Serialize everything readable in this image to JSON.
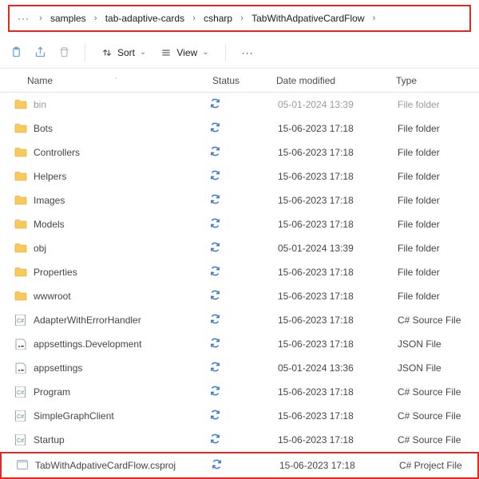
{
  "breadcrumb": {
    "ellipsis": "···",
    "items": [
      "samples",
      "tab-adaptive-cards",
      "csharp",
      "TabWithAdpativeCardFlow"
    ]
  },
  "toolbar": {
    "sort_label": "Sort",
    "view_label": "View",
    "more_label": "···"
  },
  "columns": {
    "name": "Name",
    "status": "Status",
    "date": "Date modified",
    "type": "Type"
  },
  "rows": [
    {
      "icon": "folder",
      "name": "bin",
      "status": "sync",
      "date": "05-01-2024 13:39",
      "type": "File folder",
      "dim": true
    },
    {
      "icon": "folder",
      "name": "Bots",
      "status": "sync",
      "date": "15-06-2023 17:18",
      "type": "File folder"
    },
    {
      "icon": "folder",
      "name": "Controllers",
      "status": "sync",
      "date": "15-06-2023 17:18",
      "type": "File folder"
    },
    {
      "icon": "folder",
      "name": "Helpers",
      "status": "sync",
      "date": "15-06-2023 17:18",
      "type": "File folder"
    },
    {
      "icon": "folder",
      "name": "Images",
      "status": "sync",
      "date": "15-06-2023 17:18",
      "type": "File folder"
    },
    {
      "icon": "folder",
      "name": "Models",
      "status": "sync",
      "date": "15-06-2023 17:18",
      "type": "File folder"
    },
    {
      "icon": "folder",
      "name": "obj",
      "status": "sync",
      "date": "05-01-2024 13:39",
      "type": "File folder"
    },
    {
      "icon": "folder",
      "name": "Properties",
      "status": "sync",
      "date": "15-06-2023 17:18",
      "type": "File folder"
    },
    {
      "icon": "folder",
      "name": "wwwroot",
      "status": "sync",
      "date": "15-06-2023 17:18",
      "type": "File folder"
    },
    {
      "icon": "csfile",
      "name": "AdapterWithErrorHandler",
      "status": "sync",
      "date": "15-06-2023 17:18",
      "type": "C# Source File"
    },
    {
      "icon": "jsonfile",
      "name": "appsettings.Development",
      "status": "sync",
      "date": "15-06-2023 17:18",
      "type": "JSON File"
    },
    {
      "icon": "jsonfile",
      "name": "appsettings",
      "status": "sync",
      "date": "05-01-2024 13:36",
      "type": "JSON File"
    },
    {
      "icon": "csfile",
      "name": "Program",
      "status": "sync",
      "date": "15-06-2023 17:18",
      "type": "C# Source File"
    },
    {
      "icon": "csfile",
      "name": "SimpleGraphClient",
      "status": "sync",
      "date": "15-06-2023 17:18",
      "type": "C# Source File"
    },
    {
      "icon": "csfile",
      "name": "Startup",
      "status": "sync",
      "date": "15-06-2023 17:18",
      "type": "C# Source File"
    },
    {
      "icon": "projfile",
      "name": "TabWithAdpativeCardFlow.csproj",
      "status": "sync",
      "date": "15-06-2023 17:18",
      "type": "C# Project File",
      "highlight": true
    }
  ]
}
